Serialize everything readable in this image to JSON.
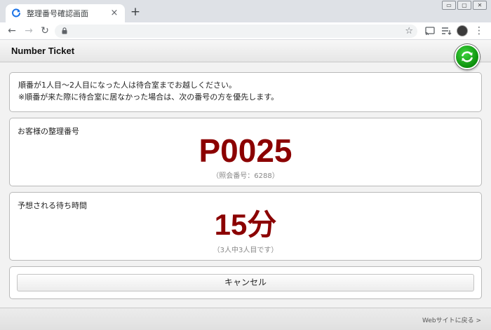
{
  "browser": {
    "tab_title": "整理番号確認画面",
    "tab_close": "×",
    "new_tab": "+",
    "nav_back": "←",
    "nav_forward": "→",
    "nav_reload": "↻",
    "star": "☆",
    "menu": "⋮",
    "favicon_color": "#1a73e8",
    "icons": [
      "back-arrow-icon",
      "forward-arrow-icon",
      "reload-icon",
      "lock-icon",
      "star-icon",
      "cast-icon",
      "reading-list-icon",
      "profile-avatar",
      "more-menu-icon"
    ]
  },
  "app": {
    "title": "Number Ticket",
    "refresh_icon": "refresh-icon",
    "accent_color": "#11a811"
  },
  "notice": {
    "line1": "順番が1人目～2人目になった人は待合室までお越しください。",
    "line2": "※順番が来た際に待合室に居なかった場合は、次の番号の方を優先します。"
  },
  "ticket": {
    "label": "お客様の整理番号",
    "number": "P0025",
    "reference": "（照会番号：6288）",
    "number_color": "#8b0000"
  },
  "wait": {
    "label": "予想される待ち時間",
    "time": "15分",
    "position": "（3人中3人目です）"
  },
  "actions": {
    "cancel_label": "キャンセル"
  },
  "footer": {
    "back_link": "Webサイトに戻る >"
  }
}
